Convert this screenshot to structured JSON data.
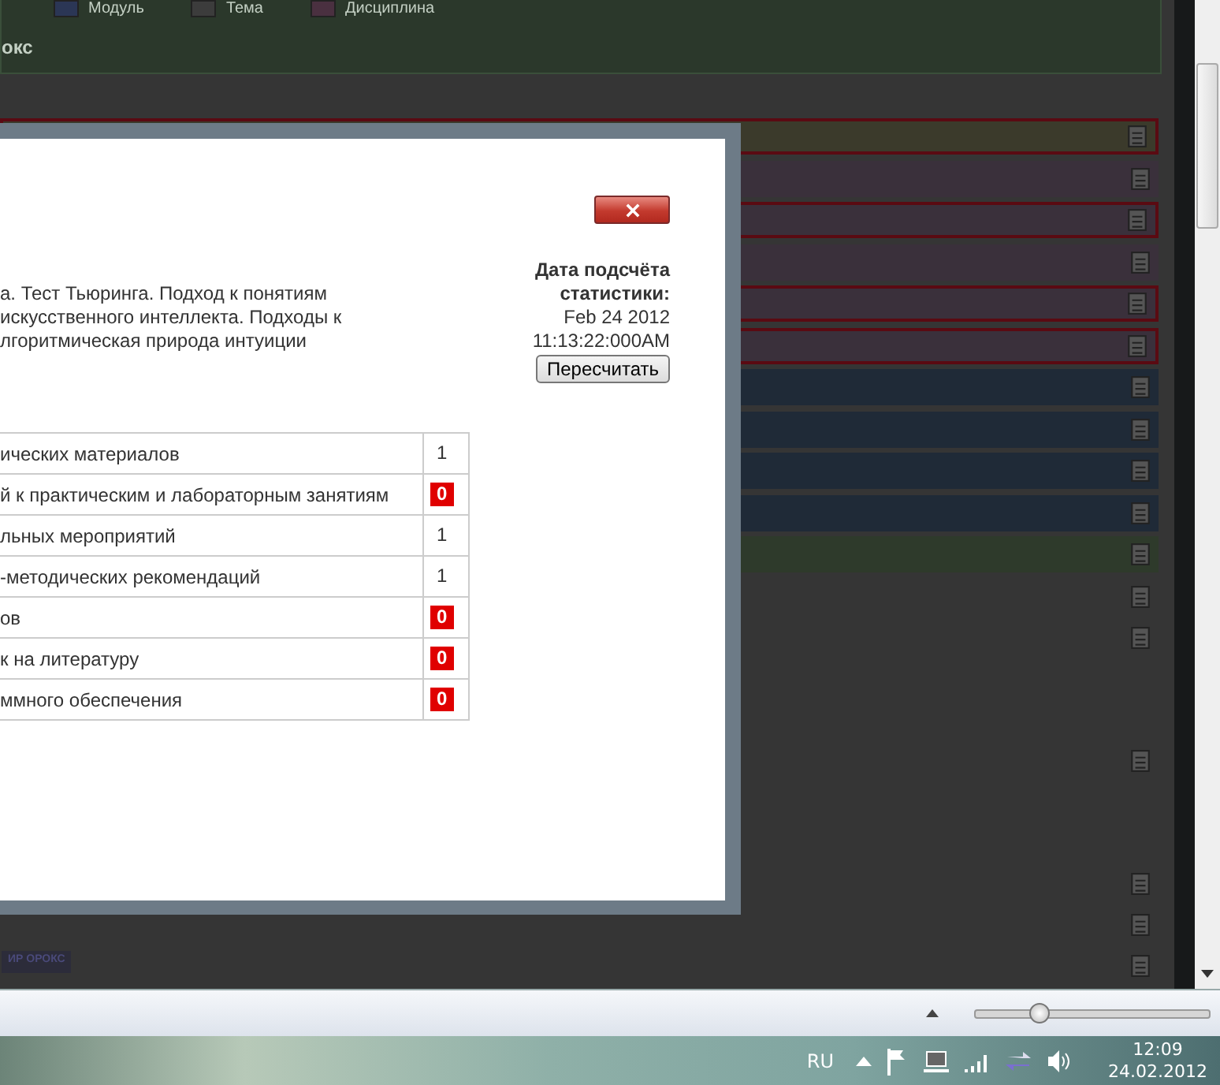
{
  "top_panel": {
    "legend": [
      {
        "label": "Модуль",
        "color": "#2b3655"
      },
      {
        "label": "Тема",
        "color": "#3c3c3c"
      },
      {
        "label": "Дисциплина",
        "color": "#4a3040"
      }
    ],
    "title": "окс"
  },
  "list_rows": [
    {
      "kind": "band",
      "color": "#3b3a2b",
      "flagged": true
    },
    {
      "kind": "band",
      "color": "#3a303b",
      "flagged": false
    },
    {
      "kind": "band",
      "color": "#3a303b",
      "flagged": true
    },
    {
      "kind": "band",
      "color": "#3a303b",
      "flagged": false
    },
    {
      "kind": "band",
      "color": "#3a303b",
      "flagged": true
    },
    {
      "kind": "band",
      "color": "#3a303b",
      "flagged": true
    },
    {
      "kind": "band",
      "color": "#1f2a37",
      "flagged": false
    },
    {
      "kind": "band",
      "color": "#1f2a37",
      "flagged": false
    },
    {
      "kind": "band",
      "color": "#1f2a37",
      "flagged": false
    },
    {
      "kind": "band",
      "color": "#1f2a37",
      "flagged": false
    },
    {
      "kind": "band",
      "color": "#2e3a2b",
      "flagged": false
    },
    {
      "kind": "blank",
      "icon": true
    },
    {
      "kind": "blank",
      "icon": true
    },
    {
      "kind": "blank",
      "icon": false
    },
    {
      "kind": "blank",
      "icon": false
    },
    {
      "kind": "blank",
      "icon": true
    },
    {
      "kind": "blank",
      "icon": false
    },
    {
      "kind": "blank",
      "icon": false
    },
    {
      "kind": "blank",
      "icon": true
    },
    {
      "kind": "blank",
      "icon": true
    },
    {
      "kind": "blank",
      "icon": true
    }
  ],
  "badge": "ИР ОРОКС",
  "dialog": {
    "description_lines": [
      "а. Тест Тьюринга. Подход к понятиям",
      "искусственного интеллекта. Подходы к",
      "лгоритмическая природа интуиции"
    ],
    "stats": {
      "label": "Дата подсчёта статистики:",
      "date": "Feb 24 2012",
      "time": "11:13:22:000AM",
      "button": "Пересчитать"
    },
    "table": [
      {
        "label": "ических материалов",
        "value": "1",
        "alert": false
      },
      {
        "label": "й к практическим и лабораторным занятиям",
        "value": "0",
        "alert": true
      },
      {
        "label": "льных мероприятий",
        "value": "1",
        "alert": false
      },
      {
        "label": "-методических рекомендаций",
        "value": "1",
        "alert": false
      },
      {
        "label": "ов",
        "value": "0",
        "alert": true
      },
      {
        "label": "к на литературу",
        "value": "0",
        "alert": true
      },
      {
        "label": "ммного обеспечения",
        "value": "0",
        "alert": true
      }
    ]
  },
  "status_bar": {
    "zoom": {
      "level": 0.27
    }
  },
  "taskbar": {
    "language": "RU",
    "time": "12:09",
    "date": "24.02.2012"
  }
}
